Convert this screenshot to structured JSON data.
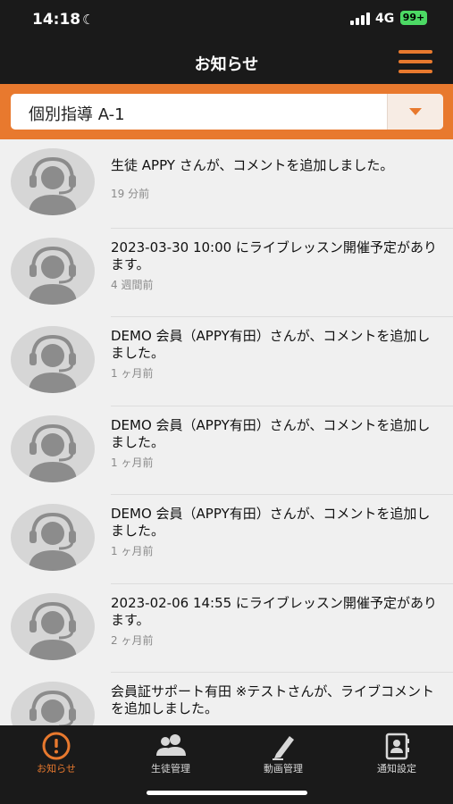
{
  "status_bar": {
    "time": "14:18",
    "network": "4G",
    "battery": "99+"
  },
  "header": {
    "title": "お知らせ"
  },
  "course_selector": {
    "value": "個別指導 A-1"
  },
  "notifications": [
    {
      "text": "生徒 APPY さんが、コメントを追加しました。",
      "time": "19 分前"
    },
    {
      "text": "2023-03-30 10:00 にライブレッスン開催予定があります。",
      "time": "4 週間前"
    },
    {
      "text": "DEMO 会員（APPY有田）さんが、コメントを追加しました。",
      "time": "1 ヶ月前"
    },
    {
      "text": "DEMO 会員（APPY有田）さんが、コメントを追加しました。",
      "time": "1 ヶ月前"
    },
    {
      "text": "DEMO 会員（APPY有田）さんが、コメントを追加しました。",
      "time": "1 ヶ月前"
    },
    {
      "text": "2023-02-06 14:55 にライブレッスン開催予定があります。",
      "time": "2 ヶ月前"
    },
    {
      "text": "会員証サポート有田 ※テストさんが、ライブコメントを追加しました。",
      "time": ""
    }
  ],
  "tabs": [
    {
      "label": "お知らせ",
      "icon": "alert-circle-icon",
      "active": true
    },
    {
      "label": "生徒管理",
      "icon": "users-icon",
      "active": false
    },
    {
      "label": "動画管理",
      "icon": "pen-icon",
      "active": false
    },
    {
      "label": "通知設定",
      "icon": "contacts-book-icon",
      "active": false
    }
  ],
  "colors": {
    "accent": "#e8792e",
    "bar_background": "#1a1a1a",
    "list_background": "#f0f0f0"
  }
}
